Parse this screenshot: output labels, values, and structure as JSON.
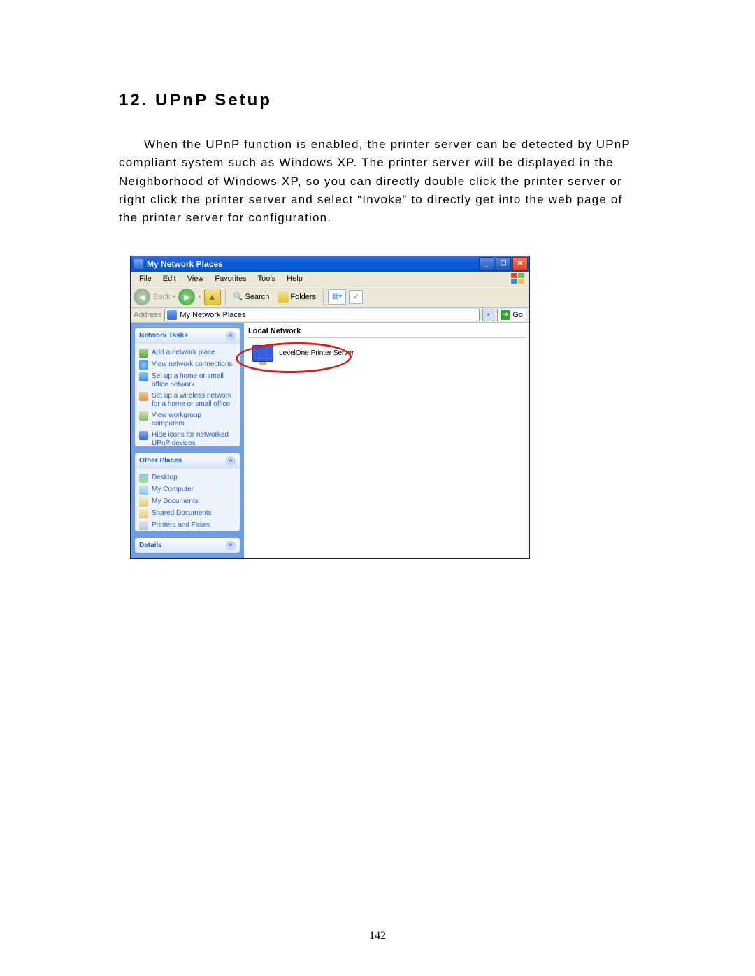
{
  "doc": {
    "heading": "12.   UPnP Setup",
    "paragraph": "When the UPnP function is enabled, the printer server can be detected by UPnP compliant system such as Windows XP. The printer server will be displayed in the Neighborhood of Windows XP, so you can directly double click the printer server or right click the printer server and select “Invoke” to directly get into the web page of the printer server for configuration.",
    "page_number": "142"
  },
  "window": {
    "title": "My Network Places",
    "menus": [
      "File",
      "Edit",
      "View",
      "Favorites",
      "Tools",
      "Help"
    ],
    "toolbar": {
      "back": "Back",
      "search": "Search",
      "folders": "Folders"
    },
    "address": {
      "label": "Address",
      "value": "My Network Places",
      "go": "Go"
    },
    "sidebar": {
      "network_tasks": {
        "title": "Network Tasks",
        "items": [
          "Add a network place",
          "View network connections",
          "Set up a home or small office network",
          "Set up a wireless network for a home or small office",
          "View workgroup computers",
          "Hide icons for networked UPnP devices"
        ]
      },
      "other_places": {
        "title": "Other Places",
        "items": [
          "Desktop",
          "My Computer",
          "My Documents",
          "Shared Documents",
          "Printers and Faxes"
        ]
      },
      "details": {
        "title": "Details"
      }
    },
    "content": {
      "group": "Local Network",
      "device": "LevelOne Printer Server"
    }
  }
}
